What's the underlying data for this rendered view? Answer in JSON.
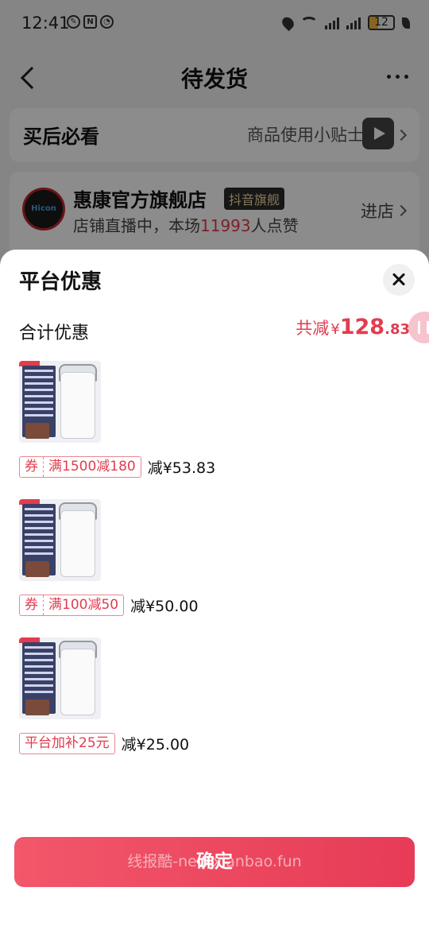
{
  "status_bar": {
    "time": "12:41",
    "battery_level": "12",
    "icons": [
      "chat-icon",
      "nfc-icon",
      "alarm-icon",
      "location-icon",
      "wifi-icon",
      "signal-icon",
      "signal-icon",
      "battery-icon",
      "leaf-icon"
    ]
  },
  "nav": {
    "title": "待发货"
  },
  "tips": {
    "title": "买后必看",
    "link": "商品使用小贴士"
  },
  "shop": {
    "logo_text": "Hicon",
    "name": "惠康官方旗舰店",
    "badge": "抖音旗舰",
    "live_prefix": "店铺直播中，本场",
    "live_count": "11993",
    "live_suffix": "人点赞",
    "enter": "进店"
  },
  "sheet": {
    "title": "平台优惠",
    "total_label": "合计优惠",
    "total_prefix": "共减",
    "total_currency": "¥",
    "total_int": "128",
    "total_dec": ".83",
    "items": [
      {
        "coupon_prefix": "券",
        "coupon_text": "满1500减180",
        "reduce": "减¥53.83"
      },
      {
        "coupon_prefix": "券",
        "coupon_text": "满100减50",
        "reduce": "减¥50.00"
      },
      {
        "coupon_prefix": "",
        "coupon_text": "平台加补25元",
        "reduce": "减¥25.00"
      }
    ],
    "confirm": "确定",
    "watermark": "线报酷-new.xianbao.fun"
  },
  "colors": {
    "accent": "#e23c4e",
    "button_start": "#f2576a",
    "button_end": "#e73b57"
  }
}
